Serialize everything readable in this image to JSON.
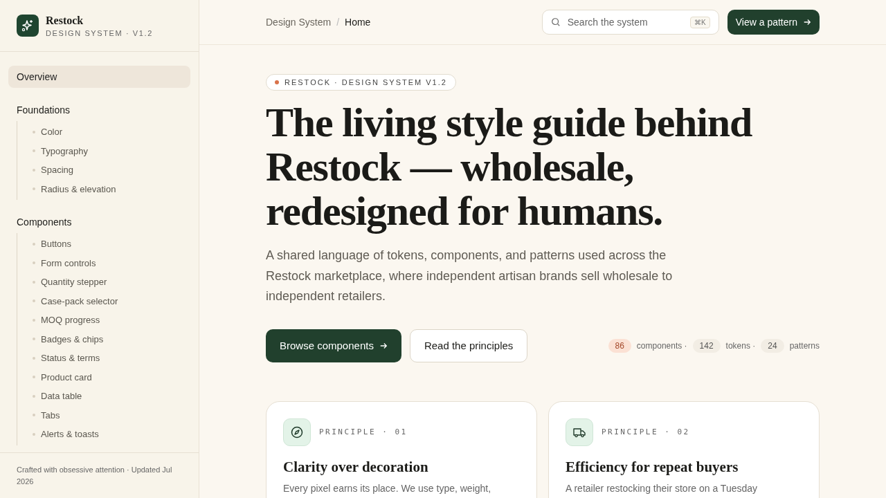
{
  "brand": {
    "name": "Restock",
    "subtitle": "DESIGN SYSTEM · V1.2"
  },
  "sidebar": {
    "items": [
      {
        "label": "Overview",
        "selected": true
      }
    ],
    "sections": [
      {
        "title": "Foundations",
        "children": [
          {
            "label": "Color",
            "selected": false
          },
          {
            "label": "Typography",
            "selected": false
          },
          {
            "label": "Spacing",
            "selected": false
          },
          {
            "label": "Radius & elevation",
            "selected": false
          }
        ]
      },
      {
        "title": "Components",
        "children": [
          {
            "label": "Buttons",
            "selected": false
          },
          {
            "label": "Form controls",
            "selected": false
          },
          {
            "label": "Quantity stepper",
            "selected": false
          },
          {
            "label": "Case-pack selector",
            "selected": false
          },
          {
            "label": "MOQ progress",
            "selected": false
          },
          {
            "label": "Badges & chips",
            "selected": false
          },
          {
            "label": "Status & terms",
            "selected": false
          },
          {
            "label": "Product card",
            "selected": false
          },
          {
            "label": "Data table",
            "selected": false
          },
          {
            "label": "Tabs",
            "selected": false
          },
          {
            "label": "Alerts & toasts",
            "selected": false
          }
        ]
      }
    ],
    "footer": "Crafted with obsessive attention · Updated Jul 2026"
  },
  "breadcrumb": [
    "Design System",
    "Home"
  ],
  "breadcrumb_separator": "/",
  "search": {
    "placeholder": "Search the system",
    "shortcut": "⌘K"
  },
  "top_button": "View a pattern",
  "hero": {
    "eyebrow": "RESTOCK · DESIGN SYSTEM V1.2",
    "title": "The living style guide behind Restock — wholesale, redesigned for humans.",
    "lead": "A shared language of tokens, components, and patterns used across the Restock marketplace, where independent artisan brands sell wholesale to independent retailers.",
    "primary": "Browse components",
    "secondary": "Read the principles",
    "stats": [
      {
        "count": "86",
        "label": "components ·",
        "kind": "accent"
      },
      {
        "count": "142",
        "label": "tokens ·",
        "kind": "plain"
      },
      {
        "count": "24",
        "label": "patterns",
        "kind": "plain"
      }
    ]
  },
  "principles": [
    {
      "kind": "compass",
      "eyebrow": "PRINCIPLE · 01",
      "title": "Clarity over decoration",
      "body": "Every pixel earns its place. We use type, weight,"
    },
    {
      "kind": "truck",
      "eyebrow": "PRINCIPLE · 02",
      "title": "Efficiency for repeat buyers",
      "body": "A retailer restocking their store on a Tuesday"
    }
  ]
}
